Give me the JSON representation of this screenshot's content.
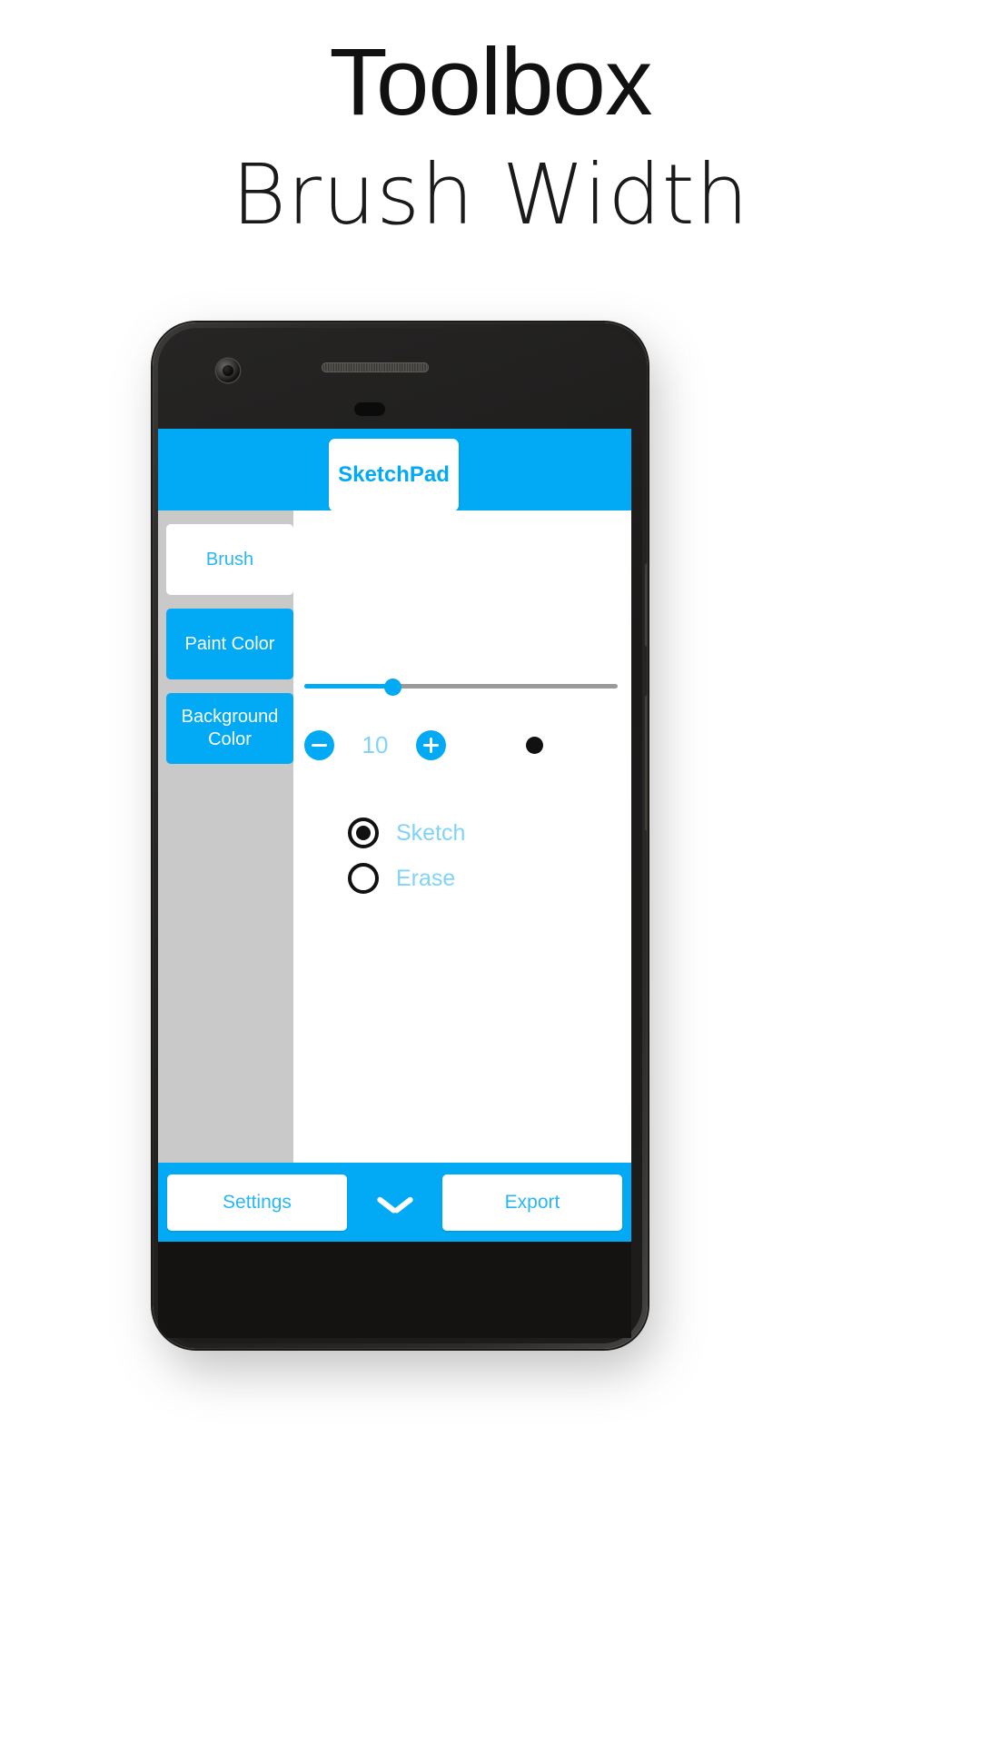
{
  "page": {
    "title": "Toolbox",
    "subtitle": "Brush Width",
    "background_color": "#ffffff"
  },
  "colors": {
    "accent_blue": "#02A9F4",
    "light_blue_text": "#7fd4f7",
    "sidebar_gray": "#c9c9c9",
    "track_gray": "#9a9a9a",
    "dark": "#111111",
    "white": "#ffffff"
  },
  "app": {
    "appbar": {
      "tab_label": "SketchPad"
    },
    "sidebar": {
      "items": [
        {
          "label": "Brush",
          "active": true
        },
        {
          "label": "Paint Color",
          "active": false
        },
        {
          "label": "Background Color",
          "active": false
        }
      ]
    },
    "brush_panel": {
      "slider": {
        "value": 10,
        "min": 1,
        "max": 36,
        "percent": 28
      },
      "stepper": {
        "decrement_label": "−",
        "increment_label": "+",
        "value": "10"
      },
      "preview": {
        "icon": "filled-dot",
        "color": "#111111"
      },
      "mode_options": [
        {
          "label": "Sketch",
          "selected": true
        },
        {
          "label": "Erase",
          "selected": false
        }
      ]
    },
    "bottombar": {
      "settings_label": "Settings",
      "expand_icon": "chevron-down-icon",
      "export_label": "Export"
    }
  },
  "device": {
    "camera": "front-camera",
    "earpiece": "earpiece-speaker",
    "sensor": "proximity-sensor"
  }
}
